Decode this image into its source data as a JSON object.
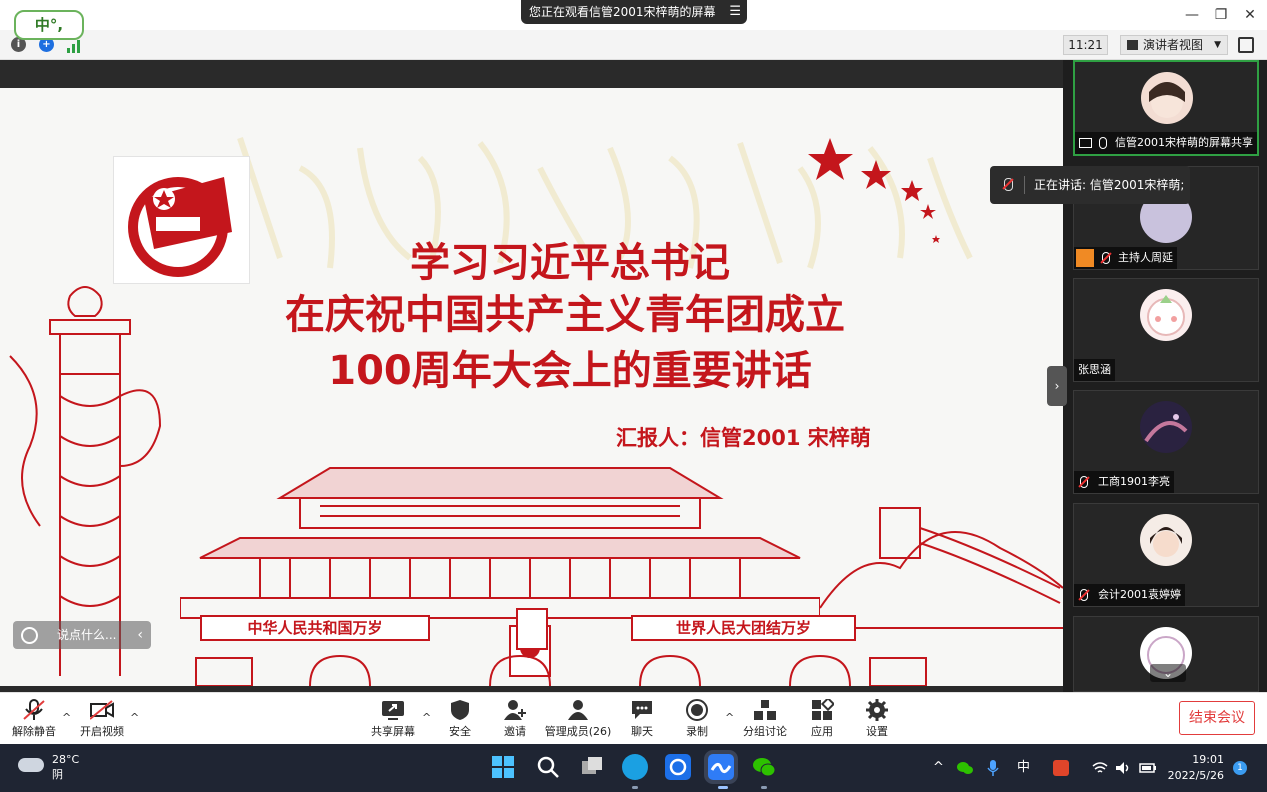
{
  "ime": {
    "label": "中°,"
  },
  "titlebar": {
    "share_notice": "您正在观看信管2001宋梓萌的屏幕",
    "minimize": "—",
    "restore": "❐",
    "close": "✕"
  },
  "subbar": {
    "time": "11:21",
    "view_mode": "演讲者视图"
  },
  "slide": {
    "title_line1": "学习习近平总书记",
    "title_line2": "在庆祝中国共产主义青年团成立",
    "title_line3": "100周年大会上的重要讲话",
    "reporter": "汇报人：信管2001 宋梓萌",
    "banner_left": "中华人民共和国万岁",
    "banner_right": "世界人民大团结万岁",
    "emblem_text": "中国共青团",
    "comment_placeholder": "说点什么..."
  },
  "speaking": {
    "text": "正在讲话: 信管2001宋梓萌;"
  },
  "participants": [
    {
      "name": "信管2001宋梓萌的屏幕共享",
      "muted": false,
      "active": true
    },
    {
      "name": "主持人周延",
      "muted": true,
      "active": false
    },
    {
      "name": "张思涵",
      "muted": false,
      "active": false
    },
    {
      "name": "工商1901李亮",
      "muted": true,
      "active": false
    },
    {
      "name": "会计2001袁婷婷",
      "muted": true,
      "active": false
    },
    {
      "name": "",
      "muted": false,
      "active": false
    }
  ],
  "toolbar": {
    "unmute": "解除静音",
    "start_video": "开启视频",
    "share_screen": "共享屏幕",
    "security": "安全",
    "invite": "邀请",
    "manage_members": "管理成员(26)",
    "chat": "聊天",
    "record": "录制",
    "breakout": "分组讨论",
    "apps": "应用",
    "settings": "设置",
    "end_meeting": "结束会议"
  },
  "taskbar": {
    "temperature": "28°C",
    "weather": "阴",
    "ime": "中",
    "time": "19:01",
    "date": "2022/5/26",
    "notifications": "1"
  },
  "colors": {
    "slide_red": "#c4161c",
    "active_border": "#2fa043",
    "end_red": "#e23c3c",
    "taskbar": "#1f2533"
  }
}
